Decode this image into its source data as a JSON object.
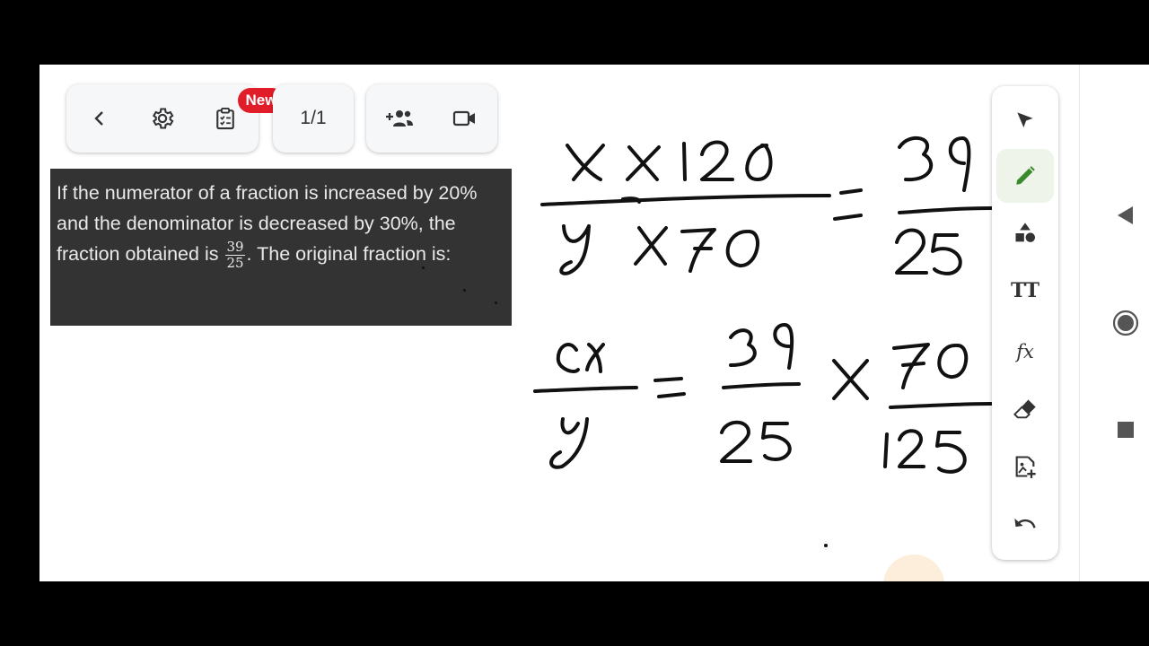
{
  "toolbar": {
    "new_badge": "New",
    "page_counter": "1/1"
  },
  "question": {
    "text_part1": "If the numerator of a fraction is increased by 20% and the denominator is decreased by 30%, the fraction obtained is ",
    "fraction_numerator": "39",
    "fraction_denominator": "25",
    "text_part2": ". The original fraction is:"
  },
  "whiteboard": {
    "eq1": {
      "lhs_num": "x X 120",
      "lhs_den": "y X 70",
      "rhs_num": "39",
      "rhs_den": "25"
    },
    "eq2": {
      "lhs_num": "x",
      "lhs_den": "y",
      "mid_num": "39",
      "mid_den": "25",
      "times": "X",
      "rhs_num": "70",
      "rhs_den": "125"
    }
  },
  "right_tools": {
    "text_tool_label": "TT",
    "formula_tool_label": "fx",
    "active_tool": "pen"
  },
  "colors": {
    "badge": "#e11d2a",
    "pen_active": "#3c8a2e",
    "question_bg": "#333333",
    "ink": "#111111"
  },
  "icons": [
    "back-icon",
    "gear-icon",
    "clipboard-icon",
    "add-person-icon",
    "video-icon",
    "pointer-icon",
    "pencil-icon",
    "shapes-icon",
    "text-icon",
    "formula-icon",
    "eraser-icon",
    "add-image-icon",
    "undo-icon",
    "back-triangle-icon",
    "home-circle-icon",
    "recents-square-icon"
  ]
}
